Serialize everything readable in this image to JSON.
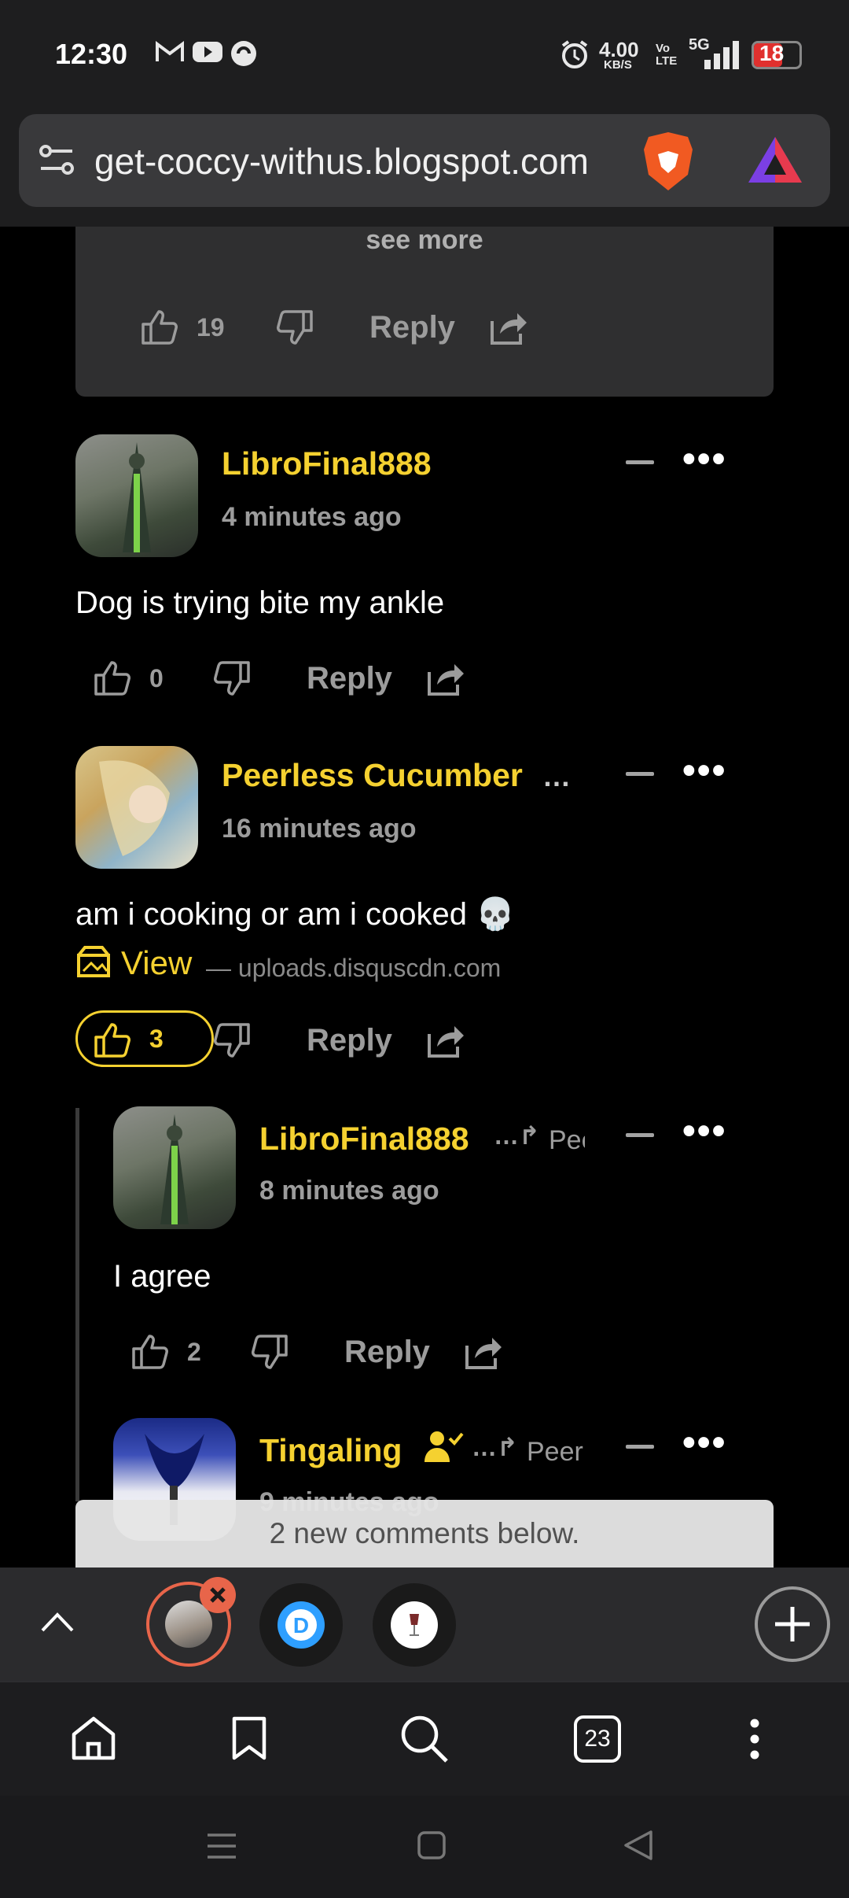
{
  "status_bar": {
    "time": "12:30",
    "net_speed": "4.00",
    "net_unit": "KB/S",
    "volte": "Vo LTE",
    "network": "5G",
    "battery": "18"
  },
  "browser": {
    "url": "get-coccy-withus.blogspot.com"
  },
  "prev_comment": {
    "see_more": "see more",
    "likes": "19",
    "reply_label": "Reply"
  },
  "comments": [
    {
      "author": "LibroFinal888",
      "time": "4 minutes ago",
      "text": "Dog is trying bite my ankle",
      "likes": "0",
      "reply_label": "Reply"
    },
    {
      "author": "Peerless Cucumber",
      "author_ellipsis": "…",
      "time": "16 minutes ago",
      "text": "am i cooking or am i cooked 💀",
      "attachment_label": "View",
      "attachment_source": "— uploads.disquscdn.com",
      "likes": "3",
      "reply_label": "Reply"
    },
    {
      "author": "LibroFinal888",
      "reply_to": "Pee",
      "time": "8 minutes ago",
      "text": "I agree",
      "likes": "2",
      "reply_label": "Reply"
    },
    {
      "author": "Tingaling",
      "reply_to": "Peer",
      "time": "9 minutes ago"
    }
  ],
  "new_comments_banner": "2 new comments below.",
  "tab_count": "23",
  "colors": {
    "accent": "#f5d130",
    "background": "#000000",
    "muted": "#9c9c9c"
  }
}
